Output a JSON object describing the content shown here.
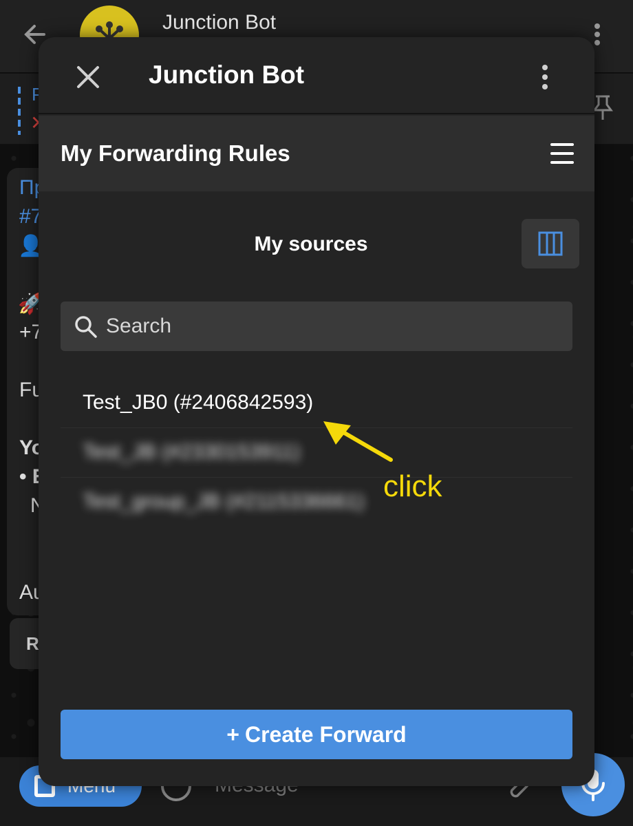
{
  "background": {
    "chat_title": "Junction Bot",
    "pinned_fragment": "P",
    "pinned_mark": "✕",
    "fragments": [
      "Пр",
      "#7",
      "👤",
      "🚀",
      "+7",
      "Fu",
      "Yo",
      "• E",
      "N",
      "Au"
    ],
    "button_fragment": "R",
    "menu_label": "Menu",
    "message_placeholder": "Message"
  },
  "modal": {
    "title": "Junction Bot"
  },
  "app": {
    "title": "My Forwarding Rules",
    "section_title": "My sources",
    "search": {
      "placeholder": "Search",
      "value": ""
    },
    "sources": [
      {
        "label": "Test_JB0 (#2406842593)",
        "blurred": false
      },
      {
        "label": "Test_JB (#2330153911)",
        "blurred": true
      },
      {
        "label": "Test_group_JB (#2115336661)",
        "blurred": true
      }
    ],
    "create_button": {
      "icon": "+",
      "label": "Create Forward"
    }
  },
  "annotation": {
    "text": "click",
    "color": "#f5d90a"
  },
  "colors": {
    "accent": "#4a8fe0",
    "panel": "#242424",
    "app_bar": "#2e2e2e"
  },
  "icons": [
    "back-arrow-icon",
    "bot-avatar",
    "more-vert-icon",
    "pin-icon",
    "close-icon",
    "hamburger-icon",
    "columns-icon",
    "search-icon",
    "plus-icon",
    "microphone-icon",
    "paperclip-icon",
    "emoji-icon"
  ]
}
